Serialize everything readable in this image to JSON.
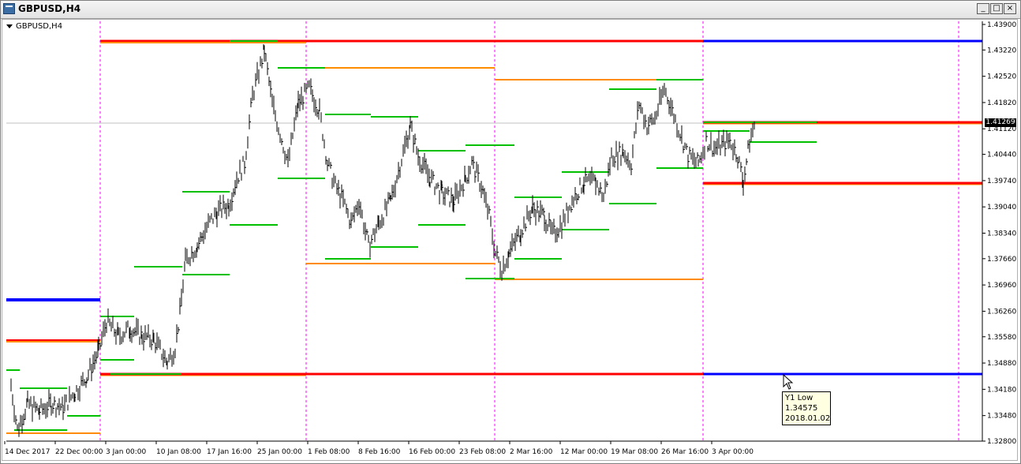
{
  "window": {
    "title": "GBPUSD,H4",
    "buttons": {
      "minimize": "_",
      "restore": "□",
      "close": "×"
    }
  },
  "chart": {
    "symbol_label": "GBPUSD,H4",
    "current_price": "1.41269"
  },
  "tooltip": {
    "line1": "Y1 Low",
    "line2": "1.34575",
    "line3": "2018.01.02"
  },
  "chart_data": {
    "type": "line",
    "x_ticks": [
      "14 Dec 2017",
      "22 Dec 00:00",
      "3 Jan 00:00",
      "10 Jan 08:00",
      "17 Jan 16:00",
      "25 Jan 00:00",
      "1 Feb 08:00",
      "8 Feb 16:00",
      "16 Feb 00:00",
      "23 Feb 08:00",
      "2 Mar 16:00",
      "12 Mar 00:00",
      "19 Mar 08:00",
      "26 Mar 16:00",
      "3 Apr 00:00"
    ],
    "y_ticks": [
      "1.43900",
      "1.43220",
      "1.42520",
      "1.41820",
      "1.41120",
      "1.40440",
      "1.39740",
      "1.39040",
      "1.38340",
      "1.37660",
      "1.36960",
      "1.36260",
      "1.35580",
      "1.34880",
      "1.34180",
      "1.33480",
      "1.32800"
    ],
    "ylim": [
      1.328,
      1.439
    ],
    "price_path": [
      [
        14,
        1.343
      ],
      [
        22,
        1.331
      ],
      [
        35,
        1.338
      ],
      [
        50,
        1.336
      ],
      [
        65,
        1.338
      ],
      [
        80,
        1.337
      ],
      [
        95,
        1.341
      ],
      [
        110,
        1.345
      ],
      [
        125,
        1.352
      ],
      [
        135,
        1.36
      ],
      [
        150,
        1.356
      ],
      [
        165,
        1.358
      ],
      [
        180,
        1.356
      ],
      [
        195,
        1.355
      ],
      [
        212,
        1.349
      ],
      [
        222,
        1.353
      ],
      [
        228,
        1.362
      ],
      [
        235,
        1.376
      ],
      [
        250,
        1.38
      ],
      [
        262,
        1.385
      ],
      [
        275,
        1.389
      ],
      [
        290,
        1.391
      ],
      [
        300,
        1.398
      ],
      [
        310,
        1.402
      ],
      [
        320,
        1.42
      ],
      [
        335,
        1.432
      ],
      [
        345,
        1.418
      ],
      [
        355,
        1.41
      ],
      [
        365,
        1.402
      ],
      [
        378,
        1.418
      ],
      [
        392,
        1.422
      ],
      [
        405,
        1.416
      ],
      [
        415,
        1.402
      ],
      [
        425,
        1.396
      ],
      [
        435,
        1.392
      ],
      [
        445,
        1.386
      ],
      [
        455,
        1.392
      ],
      [
        467,
        1.38
      ],
      [
        480,
        1.386
      ],
      [
        495,
        1.392
      ],
      [
        505,
        1.4
      ],
      [
        520,
        1.412
      ],
      [
        530,
        1.404
      ],
      [
        545,
        1.398
      ],
      [
        560,
        1.394
      ],
      [
        575,
        1.392
      ],
      [
        590,
        1.398
      ],
      [
        598,
        1.402
      ],
      [
        610,
        1.396
      ],
      [
        620,
        1.388
      ],
      [
        628,
        1.378
      ],
      [
        636,
        1.374
      ],
      [
        645,
        1.378
      ],
      [
        660,
        1.384
      ],
      [
        675,
        1.39
      ],
      [
        690,
        1.388
      ],
      [
        700,
        1.383
      ],
      [
        712,
        1.386
      ],
      [
        725,
        1.392
      ],
      [
        740,
        1.397
      ],
      [
        755,
        1.397
      ],
      [
        765,
        1.393
      ],
      [
        775,
        1.404
      ],
      [
        790,
        1.405
      ],
      [
        800,
        1.402
      ],
      [
        810,
        1.418
      ],
      [
        820,
        1.412
      ],
      [
        830,
        1.414
      ],
      [
        842,
        1.422
      ],
      [
        852,
        1.416
      ],
      [
        862,
        1.41
      ],
      [
        872,
        1.404
      ],
      [
        885,
        1.402
      ],
      [
        895,
        1.408
      ],
      [
        905,
        1.406
      ],
      [
        915,
        1.407
      ],
      [
        925,
        1.408
      ],
      [
        935,
        1.404
      ],
      [
        942,
        1.397
      ],
      [
        950,
        1.408
      ],
      [
        957,
        1.413
      ]
    ]
  },
  "colors": {
    "red_level": "#ff0000",
    "orange_level": "#ff8c00",
    "blue_level": "#0000ff",
    "green_level": "#00c000",
    "separator": "#ff00ff",
    "bars": "#000000"
  }
}
